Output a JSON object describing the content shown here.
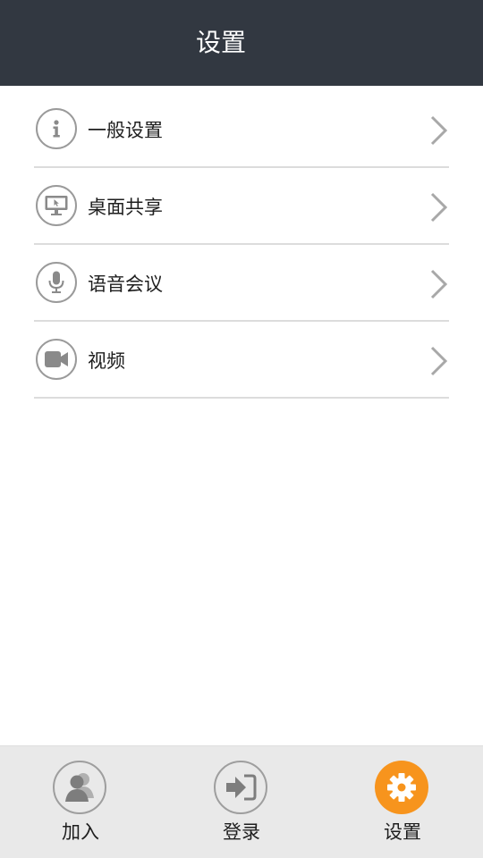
{
  "header": {
    "title": "设置"
  },
  "menu": {
    "items": [
      {
        "label": "一般设置",
        "icon": "info-icon"
      },
      {
        "label": "桌面共享",
        "icon": "monitor-icon"
      },
      {
        "label": "语音会议",
        "icon": "microphone-icon"
      },
      {
        "label": "视频",
        "icon": "video-camera-icon"
      }
    ]
  },
  "tabs": [
    {
      "label": "加入",
      "icon": "user-join-icon",
      "active": false
    },
    {
      "label": "登录",
      "icon": "login-icon",
      "active": false
    },
    {
      "label": "设置",
      "icon": "gear-icon",
      "active": true
    }
  ],
  "colors": {
    "header_bg": "#323841",
    "accent": "#f7941d",
    "icon_gray": "#9a9a9a",
    "bottom_bar_bg": "#e9e9e9"
  }
}
